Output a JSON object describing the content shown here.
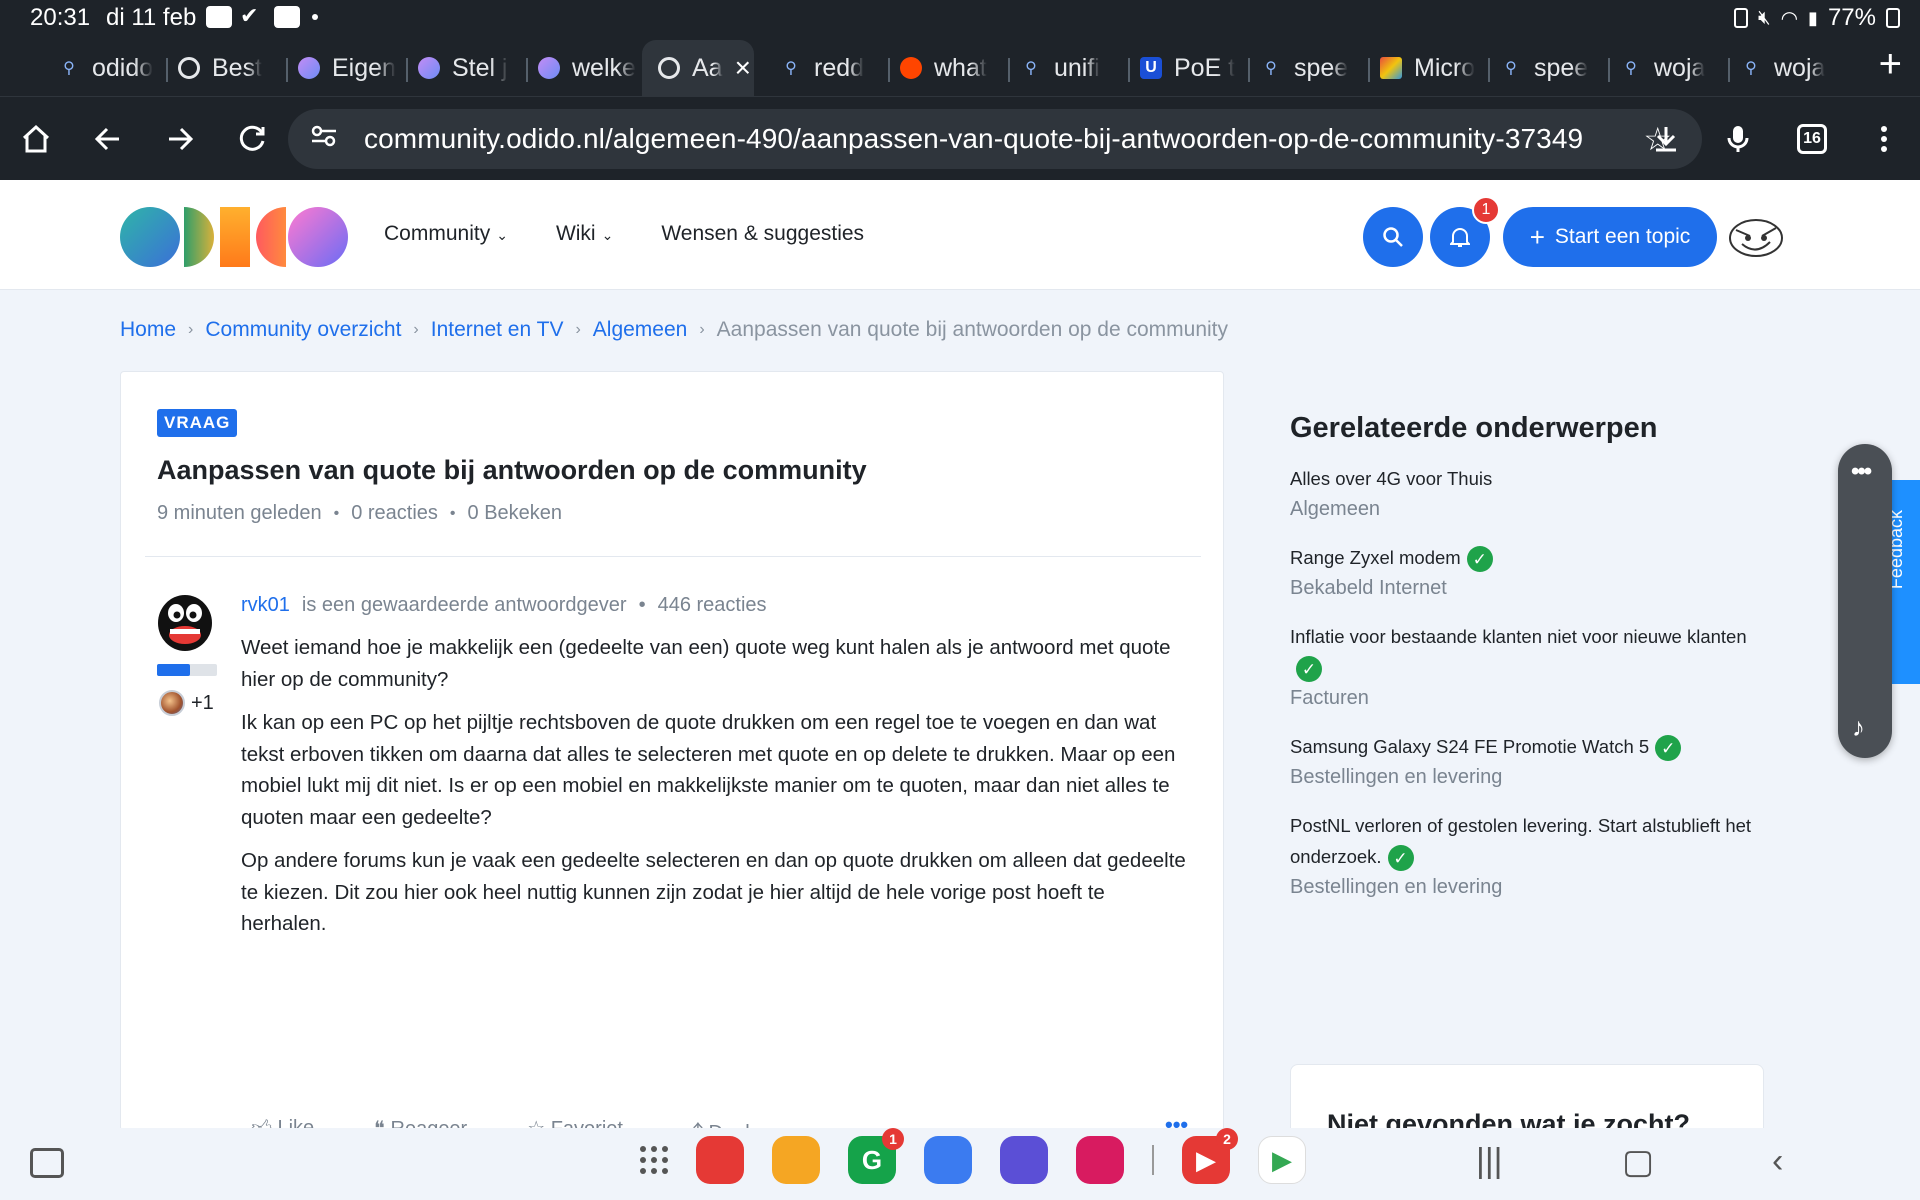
{
  "status": {
    "time": "20:31",
    "date": "di 11 feb",
    "battery": "77%"
  },
  "tabs": [
    {
      "label": "odido",
      "icon": "search-icon"
    },
    {
      "label": "Best",
      "icon": "globe-icon"
    },
    {
      "label": "Eigen",
      "icon": "odido-icon"
    },
    {
      "label": "Stel j",
      "icon": "odido-icon"
    },
    {
      "label": "welke",
      "icon": "odido-icon"
    },
    {
      "label": "Aa",
      "icon": "globe-icon",
      "active": true
    },
    {
      "label": "redd",
      "icon": "search-icon"
    },
    {
      "label": "what",
      "icon": "reddit-icon"
    },
    {
      "label": "unifi",
      "icon": "search-icon"
    },
    {
      "label": "PoE t",
      "icon": "ubiquiti-icon"
    },
    {
      "label": "spee",
      "icon": "search-icon"
    },
    {
      "label": "Micro",
      "icon": "image-icon"
    },
    {
      "label": "spee",
      "icon": "search-icon"
    },
    {
      "label": "woja",
      "icon": "search-icon"
    },
    {
      "label": "woja",
      "icon": "search-icon"
    }
  ],
  "browser": {
    "url": "community.odido.nl/algemeen-490/aanpassen-van-quote-bij-antwoorden-op-de-community-37349",
    "tab_count": "16"
  },
  "header": {
    "nav": [
      {
        "label": "Community",
        "dropdown": true
      },
      {
        "label": "Wiki",
        "dropdown": true
      },
      {
        "label": "Wensen & suggesties",
        "dropdown": false
      }
    ],
    "notification_count": "1",
    "start_topic_label": "Start een topic"
  },
  "breadcrumb": {
    "items": [
      "Home",
      "Community overzicht",
      "Internet en TV",
      "Algemeen"
    ],
    "current": "Aanpassen van quote bij antwoorden op de community"
  },
  "post": {
    "tag": "VRAAG",
    "title": "Aanpassen van quote bij antwoorden op de community",
    "age": "9 minuten geleden",
    "replies": "0 reacties",
    "views": "0 Bekeken",
    "author": "rvk01",
    "author_role": "is een gewaardeerde antwoordgever",
    "author_replies": "446 reacties",
    "rank_progress": 0.55,
    "likes_plus": "+1",
    "paragraphs": [
      "Weet iemand hoe je makkelijk een (gedeelte van een) quote weg kunt halen als je antwoord met quote hier op de community?",
      "Ik kan op een PC op het pijltje rechtsboven de quote drukken om een regel toe te voegen en dan wat tekst erboven tikken om daarna dat alles te selecteren met quote en op delete te drukken. Maar op een mobiel lukt mij dit niet. Is er op een mobiel en makkelijkste manier om te quoten, maar dan niet alles te quoten maar een gedeelte?",
      "Op andere forums kun je vaak een gedeelte selecteren en dan op quote drukken om alleen dat gedeelte te kiezen. Dit zou hier ook heel nuttig kunnen zijn zodat je hier altijd de hele vorige post hoeft te herhalen."
    ],
    "actions": [
      "Like",
      "Reageer",
      "Favoriet",
      "Deel"
    ]
  },
  "sidebar": {
    "title": "Gerelateerde onderwerpen",
    "items": [
      {
        "title": "Alles over 4G voor Thuis",
        "category": "Algemeen",
        "solved": false
      },
      {
        "title": "Range Zyxel modem",
        "category": "Bekabeld Internet",
        "solved": true
      },
      {
        "title": "Inflatie voor bestaande klanten niet voor nieuwe klanten",
        "category": "Facturen",
        "solved": true
      },
      {
        "title": "Samsung Galaxy S24 FE Promotie Watch 5",
        "category": "Bestellingen en levering",
        "solved": true
      },
      {
        "title": "PostNL verloren of gestolen levering. Start alstublieft het onderzoek.",
        "category": "Bestellingen en levering",
        "solved": true
      }
    ],
    "notfound_title": "Niet gevonden wat je zocht?",
    "feedback_label": "Feedback"
  },
  "taskbar": {
    "apps": [
      {
        "name": "apps-grid-icon"
      },
      {
        "name": "notes-app-icon",
        "color": "#e53935"
      },
      {
        "name": "files-app-icon",
        "color": "#f5a623"
      },
      {
        "name": "grammarly-app-icon",
        "color": "#15a34a",
        "badge": "1"
      },
      {
        "name": "messages-app-icon",
        "color": "#3b7bf0"
      },
      {
        "name": "internet-app-icon",
        "color": "#5b4fd6"
      },
      {
        "name": "camera-app-icon",
        "color": "#d81b60"
      },
      {
        "name": "youtube-app-icon",
        "color": "#e53935",
        "badge": "2"
      },
      {
        "name": "play-store-app-icon",
        "color": "#ffffff"
      }
    ]
  },
  "colors": {
    "accent": "#1f6feb",
    "browser_chrome": "#1e2329",
    "page_bg": "#f0f4fa",
    "check": "#1fa34a",
    "badge": "#e53935"
  }
}
